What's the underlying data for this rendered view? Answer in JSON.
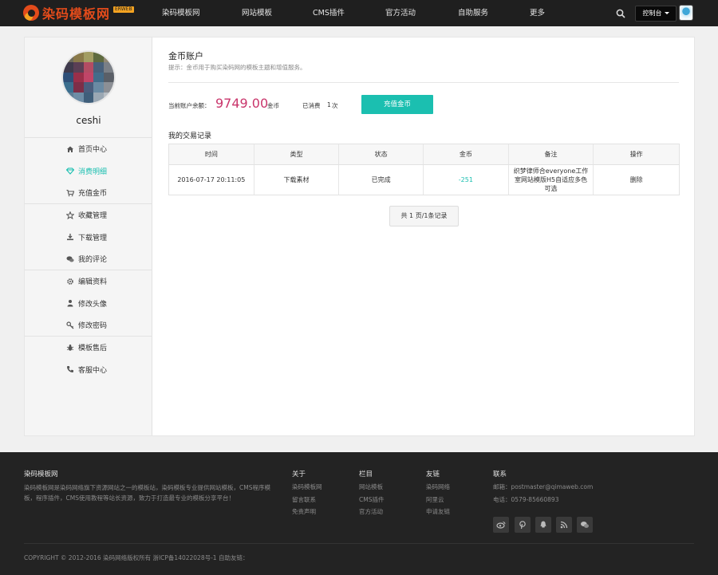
{
  "header": {
    "logo_text": "染码模板网",
    "logo_badge": "ERWEB",
    "nav": [
      "染码模板网",
      "网站模板",
      "CMS插件",
      "官方活动",
      "自助服务",
      "更多"
    ],
    "console_label": "控制台"
  },
  "sidebar": {
    "username": "ceshi",
    "groups": [
      [
        {
          "label": "首页中心",
          "icon": "home-icon",
          "active": false
        },
        {
          "label": "消费明细",
          "icon": "diamond-icon",
          "active": true
        },
        {
          "label": "充值金币",
          "icon": "cart-icon",
          "active": false
        }
      ],
      [
        {
          "label": "收藏管理",
          "icon": "star-icon",
          "active": false
        },
        {
          "label": "下载管理",
          "icon": "download-icon",
          "active": false
        },
        {
          "label": "我的评论",
          "icon": "comments-icon",
          "active": false
        }
      ],
      [
        {
          "label": "编辑资料",
          "icon": "gear-icon",
          "active": false
        },
        {
          "label": "修改头像",
          "icon": "user-icon",
          "active": false
        },
        {
          "label": "修改密码",
          "icon": "key-icon",
          "active": false
        }
      ],
      [
        {
          "label": "模板售后",
          "icon": "bug-icon",
          "active": false
        },
        {
          "label": "客服中心",
          "icon": "phone-icon",
          "active": false
        }
      ]
    ]
  },
  "account": {
    "title": "金币账户",
    "hint": "提示：金币用于购买染码网的模板主题和增值服务。",
    "balance_label": "当前账户余额：",
    "balance_value": "9749.00",
    "balance_unit": "金币",
    "spent_label": "已消费",
    "spent_count": "1",
    "spent_unit": "次",
    "recharge_label": "充值金币"
  },
  "records": {
    "title": "我的交易记录",
    "columns": [
      "时间",
      "类型",
      "状态",
      "金币",
      "备注",
      "操作"
    ],
    "rows": [
      {
        "time": "2016-07-17 20:11:05",
        "type": "下载素材",
        "status": "已完成",
        "coins": "-251",
        "note": "织梦律师合everyone工作室网站模版H5自适应多色可选",
        "action": "删除"
      }
    ],
    "pagination": "共 1 页/1条记录"
  },
  "footer": {
    "about_title": "染码模板网",
    "about_text": "染码模板网是染码网络旗下资源网站之一的模板站，染码模板专业提供网站模板，CMS程序模板，程序插件，CMS使用教程等站长资源，致力于打造最专业的模板分享平台！",
    "cols": [
      {
        "title": "关于",
        "links": [
          "染码模板网",
          "留言联系",
          "免责声明"
        ]
      },
      {
        "title": "栏目",
        "links": [
          "网站模板",
          "CMS插件",
          "官方活动"
        ]
      },
      {
        "title": "友链",
        "links": [
          "染码网络",
          "阿里云",
          "申请友链"
        ]
      }
    ],
    "contact_title": "联系",
    "email": "邮箱：postmaster@qimaweb.com",
    "phone": "电话：0579-85660893",
    "copyright": "COPYRIGHT © 2012-2016 染码网络版权所有 浙ICP备14022028号-1 自助友链："
  }
}
